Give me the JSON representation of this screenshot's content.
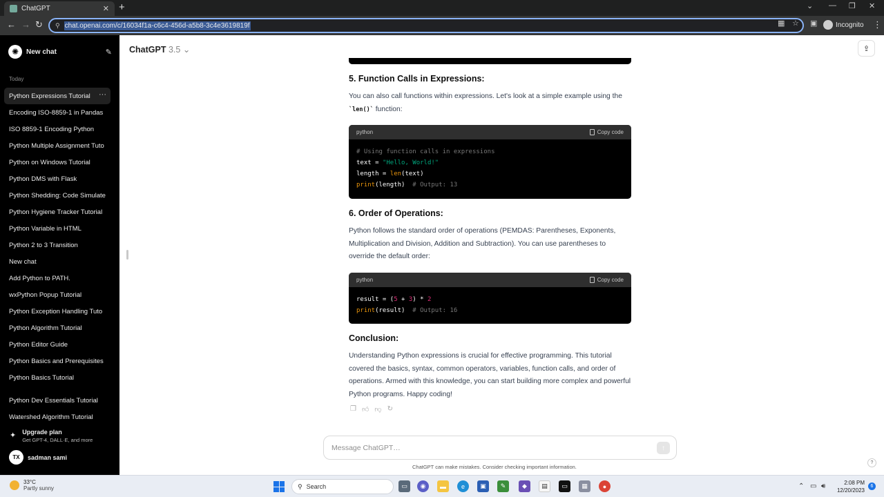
{
  "browser": {
    "tab_title": "ChatGPT",
    "url": "chat.openai.com/c/16034f1a-c6c4-456d-a5b8-3c4e3619819f",
    "profile_label": "Incognito"
  },
  "sidebar": {
    "new_chat_label": "New chat",
    "section_today": "Today",
    "chats": [
      "Python Expressions Tutorial",
      "Encoding ISO-8859-1 in Pandas",
      "ISO 8859-1 Encoding Python",
      "Python Multiple Assignment Tuto",
      "Python on Windows Tutorial",
      "Python DMS with Flask",
      "Python Shedding: Code Simulate",
      "Python Hygiene Tracker Tutorial",
      "Python Variable in HTML",
      "Python 2 to 3 Transition",
      "New chat",
      "Add Python to PATH.",
      "wxPython Popup Tutorial",
      "Python Exception Handling Tuto",
      "Python Algorithm Tutorial",
      "Python Editor Guide",
      "Python Basics and Prerequisites",
      "Python Basics Tutorial"
    ],
    "chats_more": [
      "Python Dev Essentials Tutorial",
      "Watershed Algorithm Tutorial"
    ],
    "upgrade_title": "Upgrade plan",
    "upgrade_sub": "Get GPT-4, DALL·E, and more",
    "user_initials": "TX",
    "user_name": "sadman sami"
  },
  "header": {
    "model_name": "ChatGPT",
    "model_version": "3.5"
  },
  "content": {
    "s5_title": "5. Function Calls in Expressions:",
    "s5_text_a": "You can also call functions within expressions. Let's look at a simple example using the",
    "s5_inline_code": "`len()`",
    "s5_text_b": " function:",
    "code1_lang": "python",
    "code1_copy": "Copy code",
    "code1_lines": {
      "l1": "# Using function calls in expressions",
      "l2a": "text = ",
      "l2b": "\"Hello, World!\"",
      "l3a": "length = ",
      "l3b": "len",
      "l3c": "(text)",
      "l4a": "print",
      "l4b": "(length)  ",
      "l4c": "# Output: 13"
    },
    "s6_title": "6. Order of Operations:",
    "s6_text": "Python follows the standard order of operations (PEMDAS: Parentheses, Exponents, Multiplication and Division, Addition and Subtraction). You can use parentheses to override the default order:",
    "code2_lang": "python",
    "code2_copy": "Copy code",
    "code2_lines": {
      "l1a": "result = (",
      "l1b": "5",
      "l1c": " + ",
      "l1d": "3",
      "l1e": ") * ",
      "l1f": "2",
      "l2a": "print",
      "l2b": "(result)  ",
      "l2c": "# Output: 16"
    },
    "conclusion_title": "Conclusion:",
    "conclusion_text": "Understanding Python expressions is crucial for effective programming. This tutorial covered the basics, syntax, common operators, variables, function calls, and order of operations. Armed with this knowledge, you can start building more complex and powerful Python programs. Happy coding!"
  },
  "composer": {
    "placeholder": "Message ChatGPT…",
    "disclaimer": "ChatGPT can make mistakes. Consider checking important information.",
    "help": "?"
  },
  "taskbar": {
    "temperature": "33°C",
    "condition": "Partly sunny",
    "search_label": "Search",
    "time": "2:08 PM",
    "date": "12/20/2023",
    "notification_count": "6"
  },
  "colors": {
    "sidebar_bg": "#000000",
    "code_bg": "#000000",
    "code_header": "#2f2f2f",
    "code_string": "#00a67d",
    "code_function": "#e9950c",
    "code_number": "#df3079",
    "omnibox_focus": "#8ab4f8"
  }
}
